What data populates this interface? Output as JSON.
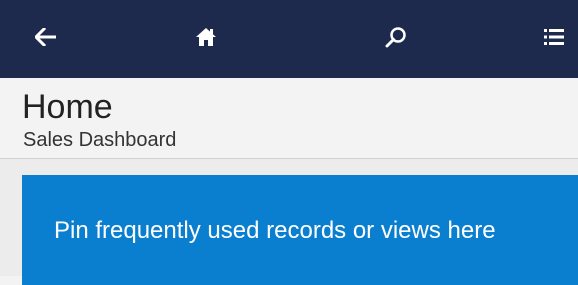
{
  "nav": {
    "back_icon": "arrow-left-icon",
    "home_icon": "home-icon",
    "search_icon": "search-icon",
    "menu_icon": "list-menu-icon"
  },
  "header": {
    "title": "Home",
    "subtitle": "Sales Dashboard"
  },
  "pin_tile": {
    "text": "Pin frequently used records or views here"
  },
  "colors": {
    "topbar": "#1e2a4d",
    "tile": "#0a7fd0",
    "background": "#f3f3f3"
  }
}
